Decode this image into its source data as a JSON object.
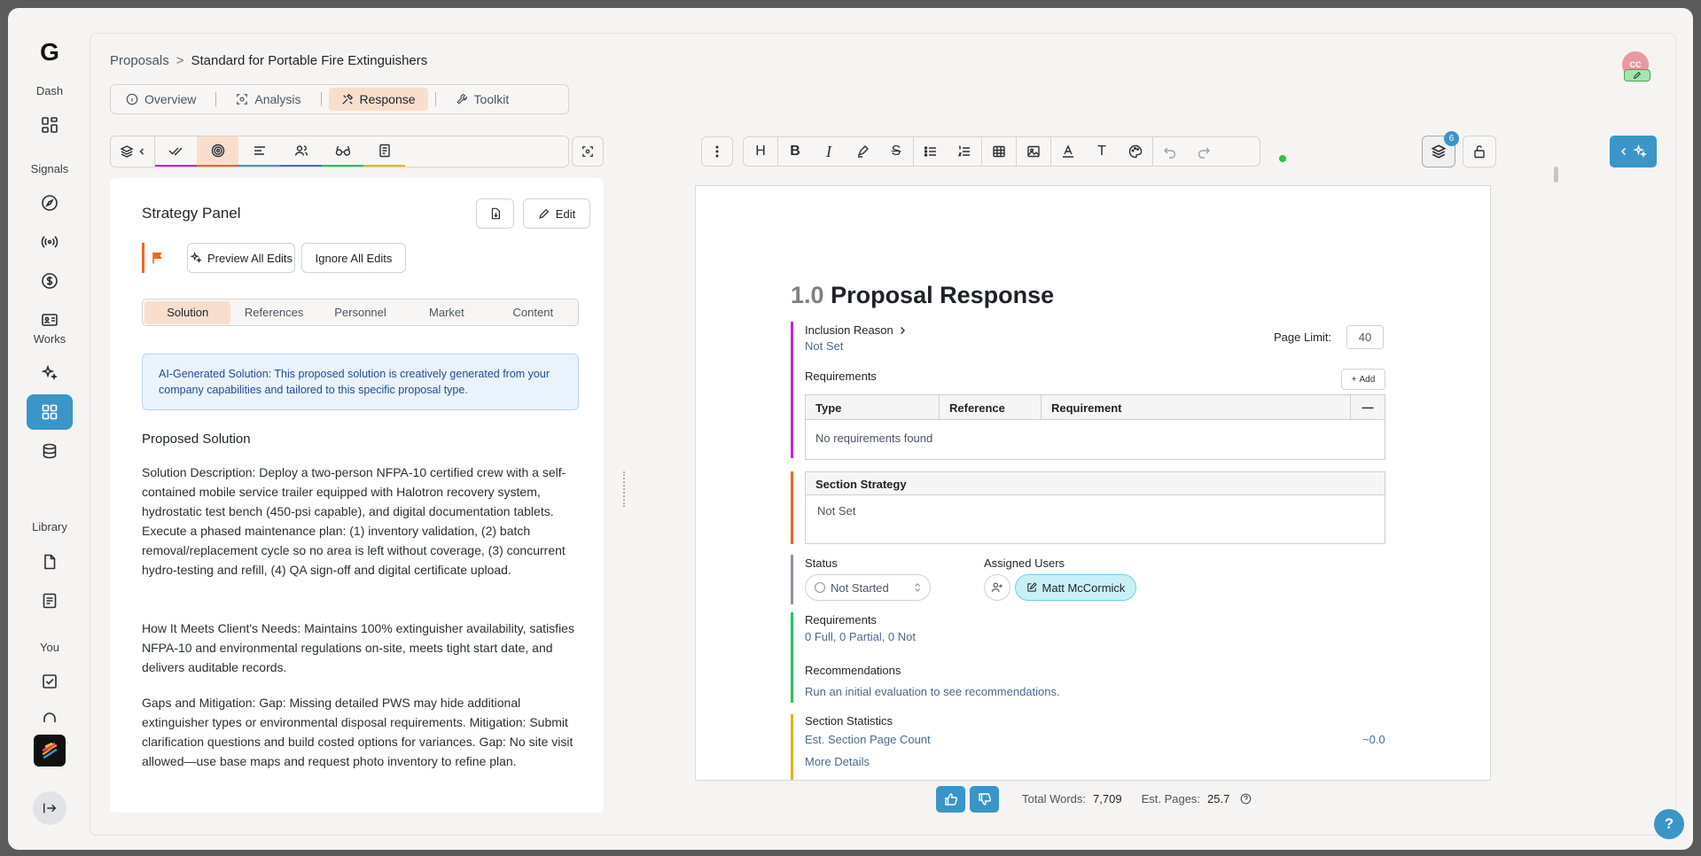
{
  "nav": {
    "logo": "G",
    "sections": {
      "dash": "Dash",
      "signals": "Signals",
      "works": "Works",
      "library": "Library",
      "you": "You"
    },
    "icons": [
      "dashboard-icon",
      "compass-icon",
      "broadcast-icon",
      "dollar-icon",
      "id-card-icon",
      "sparkles-icon",
      "grid-icon",
      "database-icon",
      "document-icon",
      "notes-icon",
      "checkbox-icon",
      "headphones-icon",
      "app-logo-icon",
      "exit-icon"
    ]
  },
  "breadcrumb": {
    "parent": "Proposals",
    "separator": ">",
    "current": "Standard for Portable Fire Extinguishers"
  },
  "tabs": [
    {
      "label": "Overview",
      "icon": "info-icon"
    },
    {
      "label": "Analysis",
      "icon": "scan-icon"
    },
    {
      "label": "Response",
      "icon": "tools-icon",
      "active": true
    },
    {
      "label": "Toolkit",
      "icon": "wrench-icon"
    }
  ],
  "user": {
    "initials": "CC"
  },
  "strategy": {
    "title": "Strategy Panel",
    "edit_label": "Edit",
    "preview_all_label": "Preview All Edits",
    "ignore_all_label": "Ignore All Edits",
    "subtabs": [
      "Solution",
      "References",
      "Personnel",
      "Market",
      "Content"
    ],
    "active_subtab": "Solution",
    "ai_note": "AI-Generated Solution: This proposed solution is creatively generated from your company capabilities and tailored to this specific proposal type.",
    "heading": "Proposed Solution",
    "paragraphs": [
      "Solution Description: Deploy a two-person NFPA-10 certified crew with a self-contained mobile service trailer equipped with Halotron recovery system, hydrostatic test bench (450-psi capable), and digital documentation tablets. Execute a phased maintenance plan: (1) inventory validation, (2) batch removal/replacement cycle so no area is left without coverage, (3) concurrent hydro-testing and refill, (4) QA sign-off and digital certificate upload.",
      "How It Meets Client's Needs: Maintains 100% extinguisher availability, satisfies NFPA-10 and environmental regulations on-site, meets tight start date, and delivers auditable records.",
      "Gaps and Mitigation: Gap: Missing detailed PWS may hide additional extinguisher types or environmental disposal requirements. Mitigation: Submit clarification questions and build costed options for variances. Gap: No site visit allowed—use base maps and request photo inventory to refine plan."
    ]
  },
  "editor": {
    "heading_button": "H",
    "bold_button": "B",
    "italic_button": "I",
    "strike_button": "S",
    "text_button": "T",
    "layers_count": "6"
  },
  "doc": {
    "section_number": "1.0",
    "section_title": "Proposal Response",
    "inclusion_reason_label": "Inclusion Reason",
    "inclusion_reason_value": "Not Set",
    "page_limit_label": "Page Limit:",
    "page_limit_value": "40",
    "requirements_label": "Requirements",
    "add_label": "Add",
    "req_columns": [
      "Type",
      "Reference",
      "Requirement"
    ],
    "req_collapse": "—",
    "req_empty": "No requirements found",
    "section_strategy_label": "Section Strategy",
    "section_strategy_value": "Not Set",
    "status_label": "Status",
    "status_value": "Not Started",
    "assigned_users_label": "Assigned Users",
    "assigned_user": "Matt McCormick",
    "req_summary_label": "Requirements",
    "req_summary_value": "0 Full, 0 Partial, 0 Not",
    "recommendations_label": "Recommendations",
    "recommendations_value": "Run an initial evaluation to see recommendations.",
    "stats_label": "Section Statistics",
    "page_count_label": "Est. Section Page Count",
    "page_count_value": "~0.0",
    "more_details": "More Details"
  },
  "footer": {
    "total_words_label": "Total Words:",
    "total_words_value": "7,709",
    "est_pages_label": "Est. Pages:",
    "est_pages_value": "25.7"
  },
  "help_label": "?",
  "colors": {
    "accent_blue": "#3a96c8",
    "active_tab": "#f8dfcd",
    "flag_orange": "#f26522",
    "bar_magenta": "#c026d3",
    "bar_orange": "#f26522",
    "bar_gray": "#8a939c",
    "bar_green": "#22c55e",
    "bar_yellow": "#eab308"
  }
}
